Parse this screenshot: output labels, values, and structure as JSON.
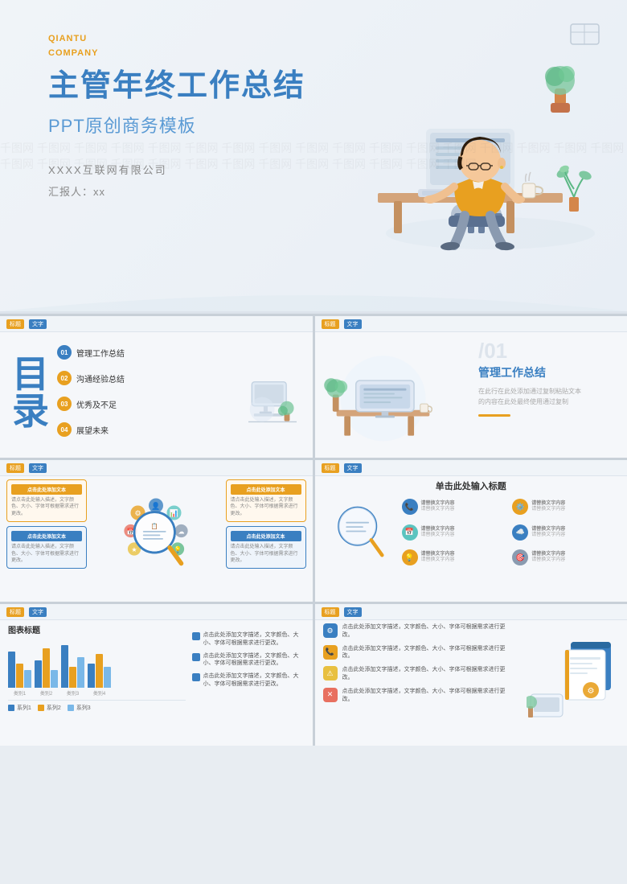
{
  "hero": {
    "brand_line1": "QIANTU",
    "brand_line2": "COMPANY",
    "title_zh": "主管年终工作总结",
    "subtitle": "PPT原创商务模板",
    "company_name": "XXXX互联网有限公司",
    "reporter": "汇报人：xx"
  },
  "slides": {
    "toc": {
      "title": "目",
      "title2": "录",
      "label_bar": [
        "标题",
        "文字"
      ],
      "items": [
        {
          "num": "01",
          "text": "管理工作总结",
          "color": "blue"
        },
        {
          "num": "02",
          "text": "沟通经验总结",
          "color": "orange"
        },
        {
          "num": "03",
          "text": "优秀及不足",
          "color": "orange"
        },
        {
          "num": "04",
          "text": "展望未来",
          "color": "orange"
        }
      ]
    },
    "section1": {
      "label_bar": [
        "标题",
        "文字"
      ],
      "number": "/01",
      "title": "管理工作总结",
      "desc": "在此行在此处添加通过复制粘贴文本\n的内容在此处最终使用通过复制"
    },
    "infographic": {
      "label_bar": [
        "标题",
        "文字"
      ],
      "cards": [
        {
          "title": "点击此处添加文本",
          "color": "orange"
        },
        {
          "title": "点击此处添加文本",
          "color": "blue"
        },
        {
          "title": "点击此处添加文本",
          "color": "orange"
        },
        {
          "title": "点击此处添加文本",
          "color": "blue"
        }
      ],
      "body_text": "请点击此处输入文本请输入描述。文字颜色、大小、字体可根据需求进行更改。"
    },
    "icons_slide": {
      "label_bar": [
        "标题",
        "文字"
      ],
      "title": "单击此处输入标题",
      "items": [
        {
          "icon": "📞",
          "label": "请替换文字内容",
          "text": "请替换文字内容"
        },
        {
          "icon": "⚙️",
          "label": "请替换文字内容",
          "text": "请替换文字内容"
        },
        {
          "icon": "📅",
          "label": "请替换文字内容",
          "text": "请替换文字内容"
        },
        {
          "icon": "☁️",
          "label": "请替换文字内容",
          "text": "请替换文字内容"
        },
        {
          "icon": "💡",
          "label": "请替换文字内容",
          "text": "请替换文字内容"
        },
        {
          "icon": "🎯",
          "label": "请替换文字内容",
          "text": "请替换文字内容"
        }
      ]
    },
    "chart_slide": {
      "label_bar": [
        "标题",
        "文字"
      ],
      "chart_title": "图表标题",
      "x_labels": [
        "类别1",
        "类别2",
        "类别3",
        "类别4"
      ],
      "series": [
        {
          "name": "系列1",
          "color": "#3a7fc1",
          "values": [
            60,
            45,
            70,
            40
          ]
        },
        {
          "name": "系列2",
          "color": "#e8a020",
          "values": [
            40,
            65,
            35,
            55
          ]
        },
        {
          "name": "系列3",
          "color": "#7ab8e8",
          "values": [
            30,
            30,
            50,
            35
          ]
        }
      ],
      "check_items": [
        "点击此处添加文字描述，文字颜色、大小、字体可根据需求进行更改。",
        "点击此处添加文字描述，文字颜色、大小、字体可根据需求进行更改。",
        "点击此处添加文字描述，文字颜色、大小、字体可根据需求进行更改。"
      ]
    },
    "textlist_slide": {
      "label_bar": [
        "标题",
        "文字"
      ],
      "items": [
        {
          "icon": "⚙️",
          "color": "blue",
          "text": "点击此处添加文字描述，文字颜色、大小、字体可根据需求进行更改。"
        },
        {
          "icon": "📞",
          "color": "orange",
          "text": "点击此处添加文字描述，文字颜色、大小、字体可根据需求进行更改。"
        },
        {
          "icon": "⚠️",
          "color": "orange-light",
          "text": "点击此处添加文字描述，文字颜色、大小、字体可根据需求进行更改。"
        },
        {
          "icon": "✕",
          "color": "red",
          "text": "点击此处添加文字描述，文字颜色、大小、字体可根据需求进行更改。"
        }
      ]
    }
  },
  "colors": {
    "blue": "#3a7fc1",
    "orange": "#e8a020",
    "light_blue": "#7ab8e8",
    "bg": "#f0f4f8",
    "text_gray": "#888888"
  }
}
